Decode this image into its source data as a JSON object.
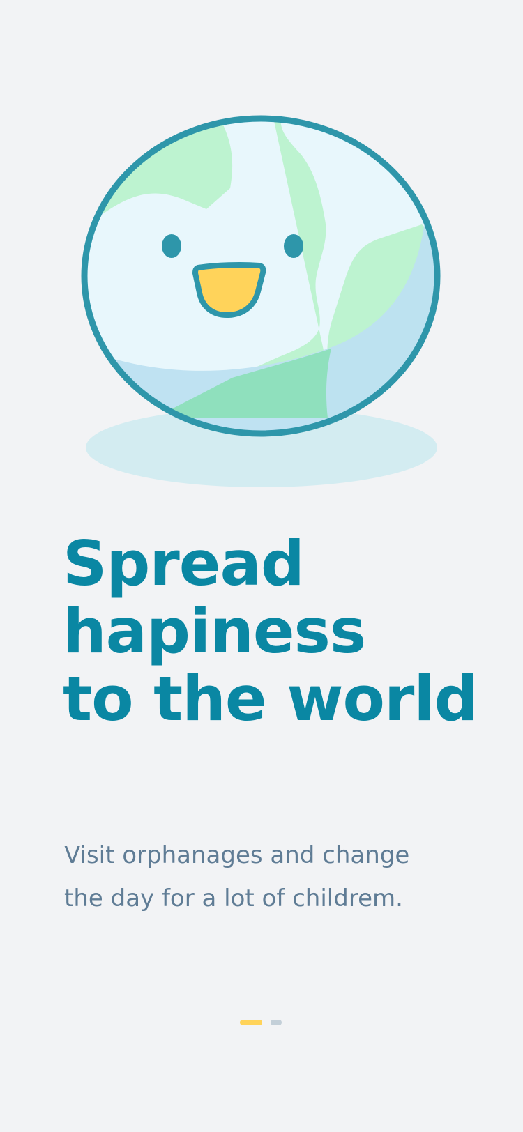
{
  "onboarding": {
    "title_lines": [
      "Spread",
      "hapiness",
      "to the world"
    ],
    "subtitle_lines": [
      "Visit orphanages and change",
      "the day for a lot of childrem."
    ],
    "pager": {
      "page_count": 2,
      "current_page": 1
    }
  },
  "illustration": {
    "icon": "smiling-globe-icon"
  },
  "colors": {
    "background": "#f2f3f5",
    "title": "#0a87a3",
    "subtitle": "#5f7c95",
    "globe_outline": "#2e96aa",
    "globe_ocean": "#e8f7fc",
    "globe_land": "#bdf3d0",
    "globe_shade": "#bde0f1",
    "globe_shadow": "#d3ecf1",
    "mouth": "#ffd35a",
    "pager_active": "#ffd35a",
    "pager_inactive": "#c3cfd8"
  }
}
